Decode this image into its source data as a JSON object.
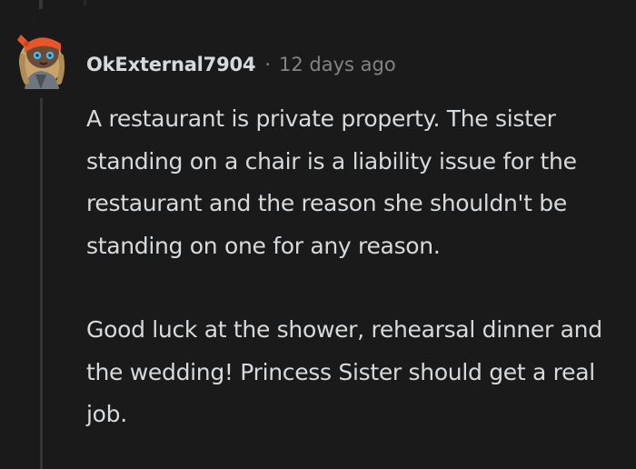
{
  "comment": {
    "username": "OkExternal7904",
    "separator": "·",
    "timestamp": "12 days ago",
    "paragraphs": [
      "A restaurant is private property. The sister standing on a chair is a liability issue for the restaurant and the reason she shouldn't be standing on one for any reason.",
      "Good luck at the shower, rehearsal dinner and the wedding! Princess Sister should get a real job."
    ]
  },
  "colors": {
    "background": "#1a1a1b",
    "text": "#d7dadc",
    "meta": "#818384",
    "thread_line": "#343536",
    "avatar_bandana": "#e8552a",
    "avatar_skin": "#6b4a36"
  },
  "icons": {
    "avatar": "snoo-avatar-icon"
  }
}
